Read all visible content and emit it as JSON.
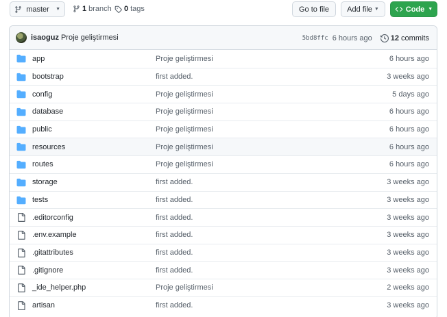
{
  "toolbar": {
    "branch_name": "master",
    "branch_count": "1",
    "branch_label": "branch",
    "tag_count": "0",
    "tag_label": "tags",
    "go_to_file": "Go to file",
    "add_file": "Add file",
    "code": "Code"
  },
  "commit": {
    "author": "isaoguz",
    "message": "Proje geliştirmesi",
    "sha": "5bd8ffc",
    "age": "6 hours ago",
    "commit_count": "12",
    "commits_label": "commits"
  },
  "files": [
    {
      "name": "app",
      "type": "folder",
      "message": "Proje geliştirmesi",
      "age": "6 hours ago"
    },
    {
      "name": "bootstrap",
      "type": "folder",
      "message": "first added.",
      "age": "3 weeks ago"
    },
    {
      "name": "config",
      "type": "folder",
      "message": "Proje geliştirmesi",
      "age": "5 days ago"
    },
    {
      "name": "database",
      "type": "folder",
      "message": "Proje geliştirmesi",
      "age": "6 hours ago"
    },
    {
      "name": "public",
      "type": "folder",
      "message": "Proje geliştirmesi",
      "age": "6 hours ago"
    },
    {
      "name": "resources",
      "type": "folder",
      "message": "Proje geliştirmesi",
      "age": "6 hours ago"
    },
    {
      "name": "routes",
      "type": "folder",
      "message": "Proje geliştirmesi",
      "age": "6 hours ago"
    },
    {
      "name": "storage",
      "type": "folder",
      "message": "first added.",
      "age": "3 weeks ago"
    },
    {
      "name": "tests",
      "type": "folder",
      "message": "first added.",
      "age": "3 weeks ago"
    },
    {
      "name": ".editorconfig",
      "type": "file",
      "message": "first added.",
      "age": "3 weeks ago"
    },
    {
      "name": ".env.example",
      "type": "file",
      "message": "first added.",
      "age": "3 weeks ago"
    },
    {
      "name": ".gitattributes",
      "type": "file",
      "message": "first added.",
      "age": "3 weeks ago"
    },
    {
      "name": ".gitignore",
      "type": "file",
      "message": "first added.",
      "age": "3 weeks ago"
    },
    {
      "name": "_ide_helper.php",
      "type": "file",
      "message": "Proje geliştirmesi",
      "age": "2 weeks ago"
    },
    {
      "name": "artisan",
      "type": "file",
      "message": "first added.",
      "age": "3 weeks ago"
    }
  ],
  "colors": {
    "folder": "#54aeff",
    "code_button": "#2da44e",
    "muted_text": "#57606a"
  }
}
